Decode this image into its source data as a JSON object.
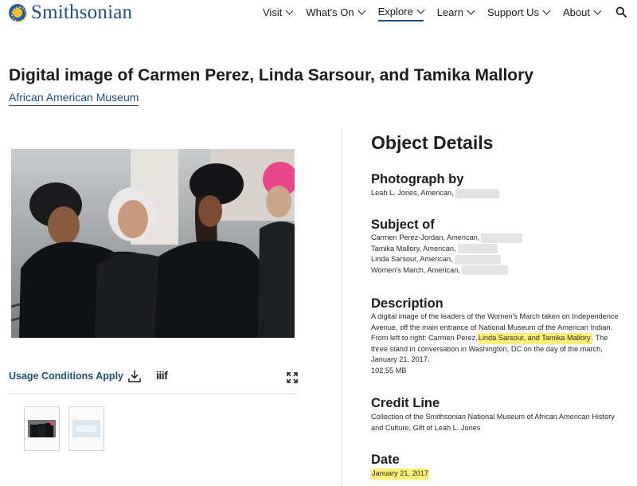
{
  "header": {
    "logo_text": "Smithsonian",
    "nav": [
      {
        "label": "Visit"
      },
      {
        "label": "What's On"
      },
      {
        "label": "Explore",
        "active": true
      },
      {
        "label": "Learn"
      },
      {
        "label": "Support Us"
      },
      {
        "label": "About"
      }
    ]
  },
  "page": {
    "title": "Digital image of Carmen Perez, Linda Sarsour, and Tamika Mallory",
    "museum": "African American Museum"
  },
  "media": {
    "usage_label": "Usage Conditions Apply",
    "iiif_label": "iiif"
  },
  "details": {
    "heading": "Object Details",
    "photographed_by": {
      "label": "Photograph by",
      "values": [
        "Leah L. Jones, American,"
      ]
    },
    "subject_of": {
      "label": "Subject of",
      "values": [
        "Carmen Perez-Jordan, American,",
        "Tamika Mallory, American,",
        "Linda Sarsour, American,",
        "Women's March, American,"
      ]
    },
    "description": {
      "label": "Description",
      "line1": "A digital image of the leaders of the Women's March taken on Independence",
      "line2": "Avenue, off the main entrance of National Museum of the American Indian.",
      "line3_pre": "From left to right: Carmen Perez, ",
      "line3_highlight": "Linda Sarsour, and Tamika Mallory",
      "line3_post": ". The",
      "line4": "three stand in conversation in Washington, DC on the day of the march,",
      "line5": "January 21, 2017.",
      "size": "102.55 MB"
    },
    "credit_line": {
      "label": "Credit Line",
      "line1": "Collection of the Smithsonian National Museum of African American History",
      "line2": "and Culture, Gift of Leah L. Jones"
    },
    "date": {
      "label": "Date",
      "value": "January 21, 2017"
    }
  },
  "colors": {
    "brand_blue": "#1f4e79",
    "highlight": "#fff176"
  }
}
